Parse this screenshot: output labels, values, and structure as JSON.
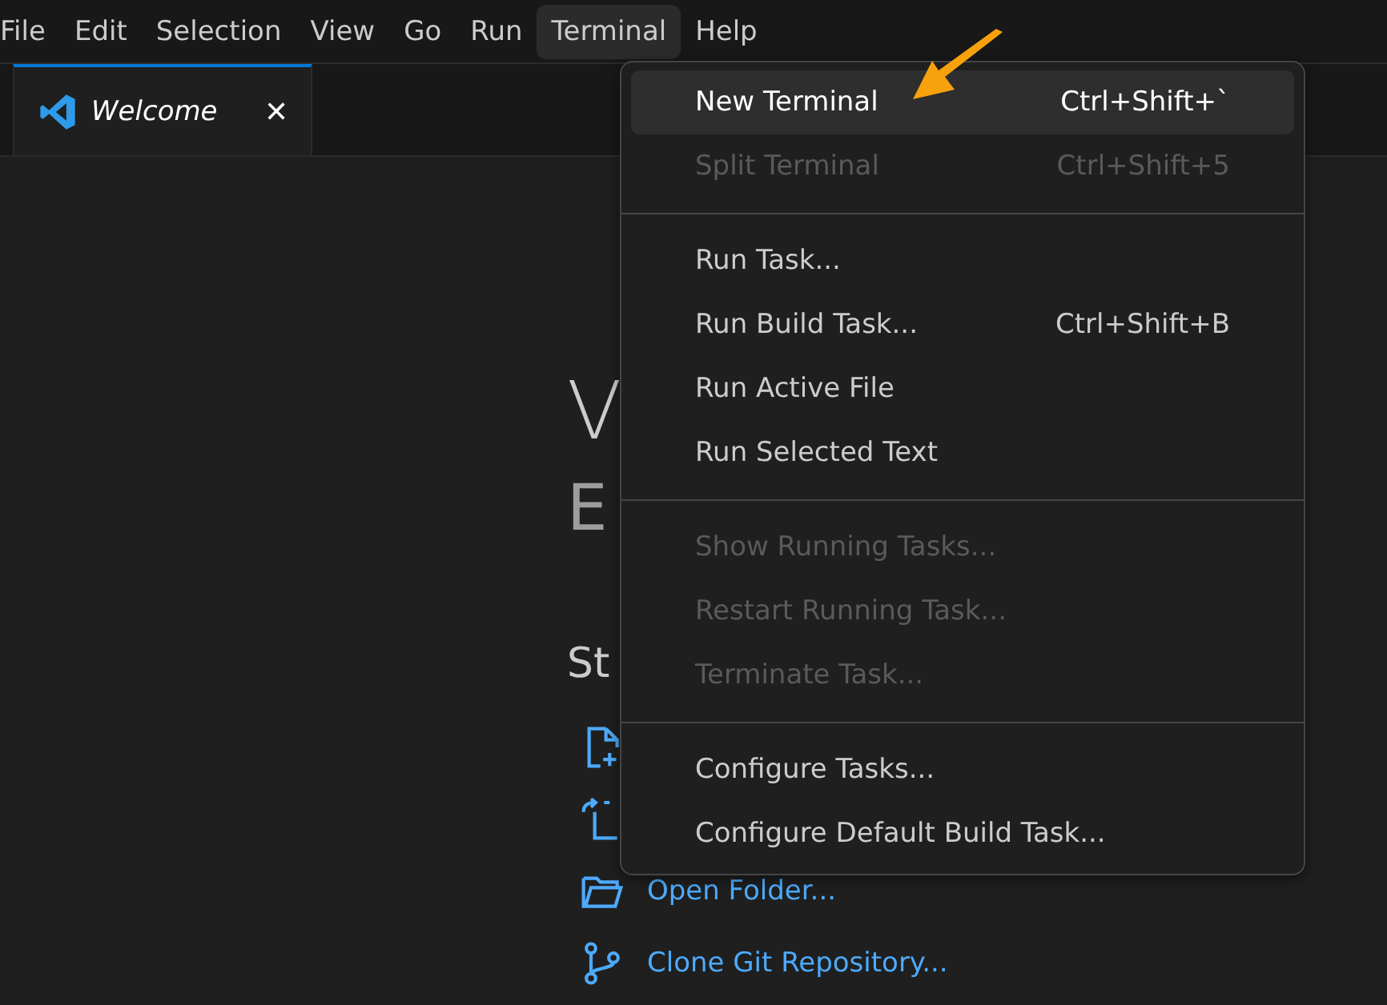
{
  "menu_bar": [
    {
      "label": "File",
      "selected": false
    },
    {
      "label": "Edit",
      "selected": false
    },
    {
      "label": "Selection",
      "selected": false
    },
    {
      "label": "View",
      "selected": false
    },
    {
      "label": "Go",
      "selected": false
    },
    {
      "label": "Run",
      "selected": false
    },
    {
      "label": "Terminal",
      "selected": true
    },
    {
      "label": "Help",
      "selected": false
    }
  ],
  "tabs": [
    {
      "label": "Welcome",
      "selected": true,
      "close": "✕"
    }
  ],
  "welcome": {
    "title": "V",
    "subtitle": "E",
    "section": "St",
    "links": [
      {
        "label": "Open Folder..."
      },
      {
        "label": "Clone Git Repository..."
      }
    ]
  },
  "terminal_menu": [
    {
      "kind": "item",
      "label": "New Terminal",
      "shortcut": "Ctrl+Shift+`",
      "disabled": false,
      "selected": true
    },
    {
      "kind": "item",
      "label": "Split Terminal",
      "shortcut": "Ctrl+Shift+5",
      "disabled": true,
      "selected": false
    },
    {
      "kind": "separator"
    },
    {
      "kind": "item",
      "label": "Run Task...",
      "disabled": false,
      "selected": false
    },
    {
      "kind": "item",
      "label": "Run Build Task...",
      "shortcut": "Ctrl+Shift+B",
      "disabled": false,
      "selected": false
    },
    {
      "kind": "item",
      "label": "Run Active File",
      "disabled": false,
      "selected": false
    },
    {
      "kind": "item",
      "label": "Run Selected Text",
      "disabled": false,
      "selected": false
    },
    {
      "kind": "separator"
    },
    {
      "kind": "item",
      "label": "Show Running Tasks...",
      "disabled": true,
      "selected": false
    },
    {
      "kind": "item",
      "label": "Restart Running Task...",
      "disabled": true,
      "selected": false
    },
    {
      "kind": "item",
      "label": "Terminate Task...",
      "disabled": true,
      "selected": false
    },
    {
      "kind": "separator"
    },
    {
      "kind": "item",
      "label": "Configure Tasks...",
      "disabled": false,
      "selected": false
    },
    {
      "kind": "item",
      "label": "Configure Default Build Task...",
      "disabled": false,
      "selected": false
    }
  ]
}
